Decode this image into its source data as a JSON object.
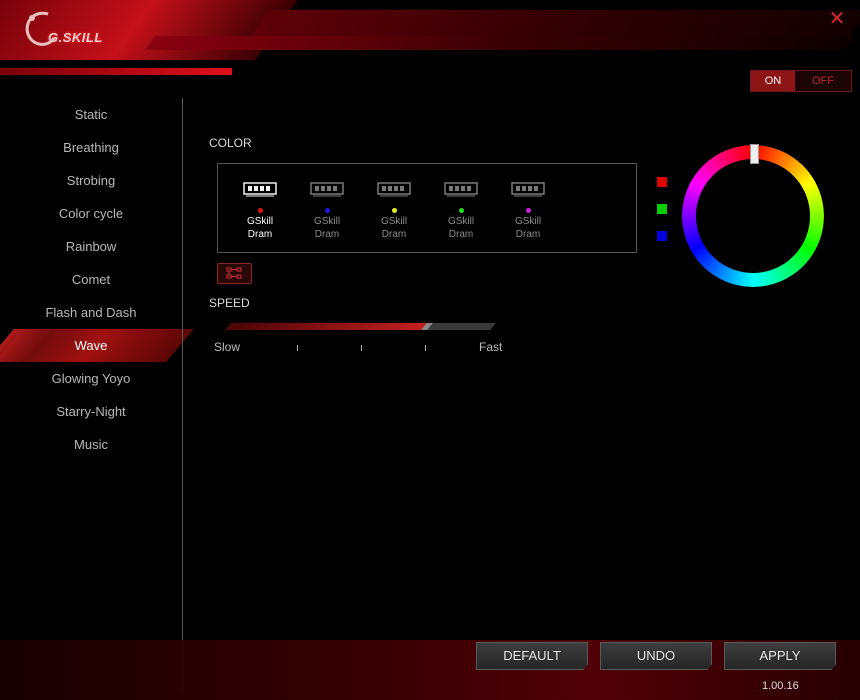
{
  "app": {
    "logo_text": "G.SKILL",
    "version": "1.00.16"
  },
  "power": {
    "on_label": "ON",
    "off_label": "OFF",
    "state": "on"
  },
  "sidebar": {
    "items": [
      {
        "label": "Static"
      },
      {
        "label": "Breathing"
      },
      {
        "label": "Strobing"
      },
      {
        "label": "Color cycle"
      },
      {
        "label": "Rainbow"
      },
      {
        "label": "Comet"
      },
      {
        "label": "Flash and Dash"
      },
      {
        "label": "Wave",
        "active": true
      },
      {
        "label": "Glowing Yoyo"
      },
      {
        "label": "Starry-Night"
      },
      {
        "label": "Music"
      }
    ]
  },
  "color_section": {
    "label": "COLOR",
    "modules": [
      {
        "line1": "GSkill",
        "line2": "Dram",
        "color": "#e0101a",
        "selected": true
      },
      {
        "line1": "GSkill",
        "line2": "Dram",
        "color": "#1a1ae0",
        "selected": false
      },
      {
        "line1": "GSkill",
        "line2": "Dram",
        "color": "#e6f020",
        "selected": false
      },
      {
        "line1": "GSkill",
        "line2": "Dram",
        "color": "#20e020",
        "selected": false
      },
      {
        "line1": "GSkill",
        "line2": "Dram",
        "color": "#d020e0",
        "selected": false
      }
    ],
    "swatches": [
      {
        "name": "red",
        "color": "#e00000"
      },
      {
        "name": "green",
        "color": "#00d000"
      },
      {
        "name": "blue",
        "color": "#0000e0"
      }
    ]
  },
  "speed_section": {
    "label": "SPEED",
    "slow_label": "Slow",
    "fast_label": "Fast",
    "value_fraction": 0.75
  },
  "buttons": {
    "default_label": "DEFAULT",
    "undo_label": "UNDO",
    "apply_label": "APPLY"
  }
}
